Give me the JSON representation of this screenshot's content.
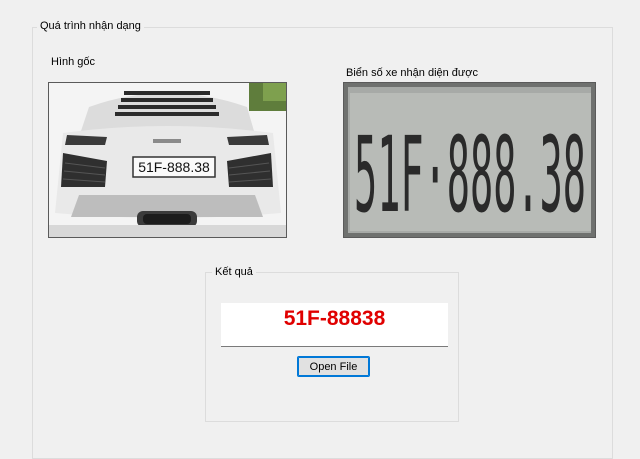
{
  "process_group": {
    "label": "Quá trình nhận dạng"
  },
  "original_image": {
    "label": "Hình gốc",
    "plate_text": "51F-888.38"
  },
  "plate_image": {
    "label": "Biển số xe nhận diện được",
    "plate_text": "51F·888.38"
  },
  "result_group": {
    "label": "Kết quả",
    "value": "51F-88838",
    "value_color": "#e00000"
  },
  "open_file_button": {
    "label": "Open File"
  }
}
